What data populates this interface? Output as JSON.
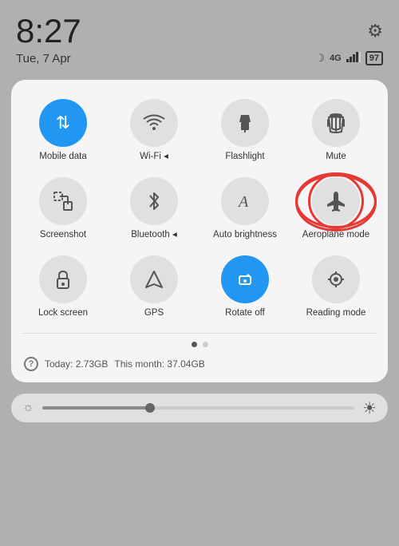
{
  "statusBar": {
    "time": "8:27",
    "date": "Tue, 7 Apr",
    "gearIcon": "⚙",
    "moonIcon": "☽",
    "signalIcon": "4G",
    "batteryIcon": "97"
  },
  "tiles": [
    {
      "id": "mobile-data",
      "label": "Mobile data",
      "icon": "mobile-data",
      "active": true,
      "highlighted": false
    },
    {
      "id": "wifi",
      "label": "Wi-Fi ◂",
      "icon": "wifi",
      "active": false,
      "highlighted": false
    },
    {
      "id": "flashlight",
      "label": "Flashlight",
      "icon": "flashlight",
      "active": false,
      "highlighted": false
    },
    {
      "id": "mute",
      "label": "Mute",
      "icon": "mute",
      "active": false,
      "highlighted": false
    },
    {
      "id": "screenshot",
      "label": "Screenshot",
      "icon": "screenshot",
      "active": false,
      "highlighted": false
    },
    {
      "id": "bluetooth",
      "label": "Bluetooth ◂",
      "icon": "bluetooth",
      "active": false,
      "highlighted": false
    },
    {
      "id": "auto-brightness",
      "label": "Auto brightness",
      "icon": "auto-brightness",
      "active": false,
      "highlighted": false
    },
    {
      "id": "aeroplane-mode",
      "label": "Aeroplane mode",
      "icon": "airplane",
      "active": false,
      "highlighted": true
    },
    {
      "id": "lock-screen",
      "label": "Lock screen",
      "icon": "lock",
      "active": false,
      "highlighted": false
    },
    {
      "id": "gps",
      "label": "GPS",
      "icon": "gps",
      "active": false,
      "highlighted": false
    },
    {
      "id": "rotate-off",
      "label": "Rotate off",
      "icon": "rotate",
      "active": true,
      "highlighted": false
    },
    {
      "id": "reading-mode",
      "label": "Reading mode",
      "icon": "reading",
      "active": false,
      "highlighted": false
    }
  ],
  "dots": [
    {
      "active": true
    },
    {
      "active": false
    }
  ],
  "dataUsage": {
    "questionMark": "?",
    "todayLabel": "Today: 2.73GB",
    "monthLabel": "This month: 37.04GB"
  },
  "brightness": {
    "leftIcon": "☼",
    "rightIcon": "☀"
  }
}
